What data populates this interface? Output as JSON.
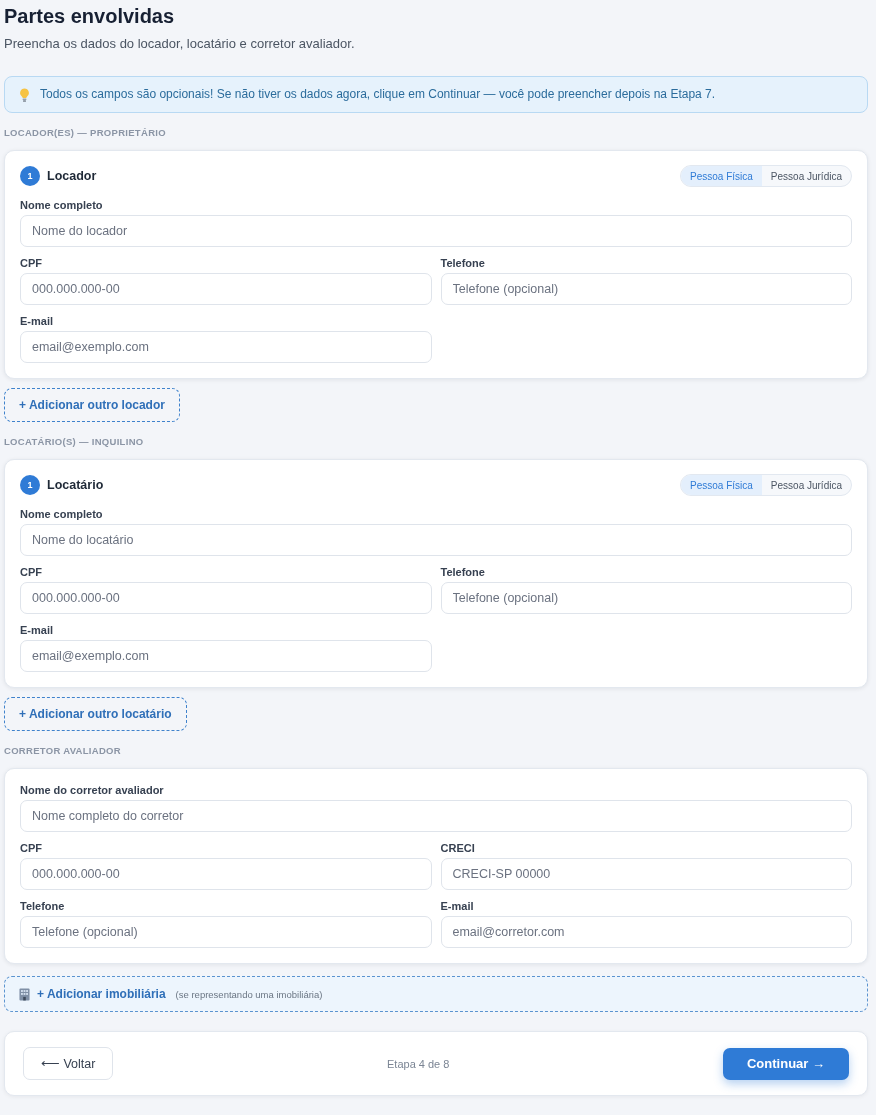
{
  "header": {
    "title": "Partes envolvidas",
    "subtitle": "Preencha os dados do locador, locatário e corretor avaliador."
  },
  "notice": {
    "text": "Todos os campos são opcionais! Se não tiver os dados agora, clique em Continuar — você pode preencher depois na Etapa 7."
  },
  "sections": [
    {
      "kind": "parties",
      "label": "LOCADOR(ES) — PROPRIETÁRIO",
      "parties": [
        {
          "number": "1",
          "title": "Locador",
          "person_types": [
            {
              "label": "Pessoa Física",
              "selected": true
            },
            {
              "label": "Pessoa Jurídica",
              "selected": false
            }
          ],
          "fields": [
            {
              "label": "Nome completo",
              "placeholder": "Nome do locador",
              "wide": true
            },
            {
              "label": "CPF",
              "placeholder": "000.000.000-00",
              "wide": false
            },
            {
              "label": "Telefone",
              "placeholder": "Telefone (opcional)",
              "wide": false
            },
            {
              "label": "E-mail",
              "placeholder": "email@exemplo.com",
              "wide": false
            }
          ]
        }
      ],
      "add_button": "+ Adicionar outro locador"
    },
    {
      "kind": "parties",
      "label": "LOCATÁRIO(S) — INQUILINO",
      "parties": [
        {
          "number": "1",
          "title": "Locatário",
          "person_types": [
            {
              "label": "Pessoa Física",
              "selected": true
            },
            {
              "label": "Pessoa Jurídica",
              "selected": false
            }
          ],
          "fields": [
            {
              "label": "Nome completo",
              "placeholder": "Nome do locatário",
              "wide": true
            },
            {
              "label": "CPF",
              "placeholder": "000.000.000-00",
              "wide": false
            },
            {
              "label": "Telefone",
              "placeholder": "Telefone (opcional)",
              "wide": false
            },
            {
              "label": "E-mail",
              "placeholder": "email@exemplo.com",
              "wide": false
            }
          ]
        }
      ],
      "add_button": "+ Adicionar outro locatário"
    },
    {
      "kind": "broker",
      "label": "CORRETOR AVALIADOR",
      "fields": [
        {
          "label": "Nome do corretor avaliador",
          "placeholder": "Nome completo do corretor",
          "wide": true
        },
        {
          "label": "CPF",
          "placeholder": "000.000.000-00",
          "wide": false
        },
        {
          "label": "CRECI",
          "placeholder": "CRECI-SP 00000",
          "wide": false
        },
        {
          "label": "Telefone",
          "placeholder": "Telefone (opcional)",
          "wide": false
        },
        {
          "label": "E-mail",
          "placeholder": "email@corretor.com",
          "wide": false
        }
      ],
      "add_button": "+ Adicionar imobiliária",
      "add_note": "(se representando uma imobiliária)"
    }
  ],
  "footer": {
    "back": "⟵ Voltar",
    "step": "Etapa 4 de 8",
    "continue": "Continuar →"
  }
}
